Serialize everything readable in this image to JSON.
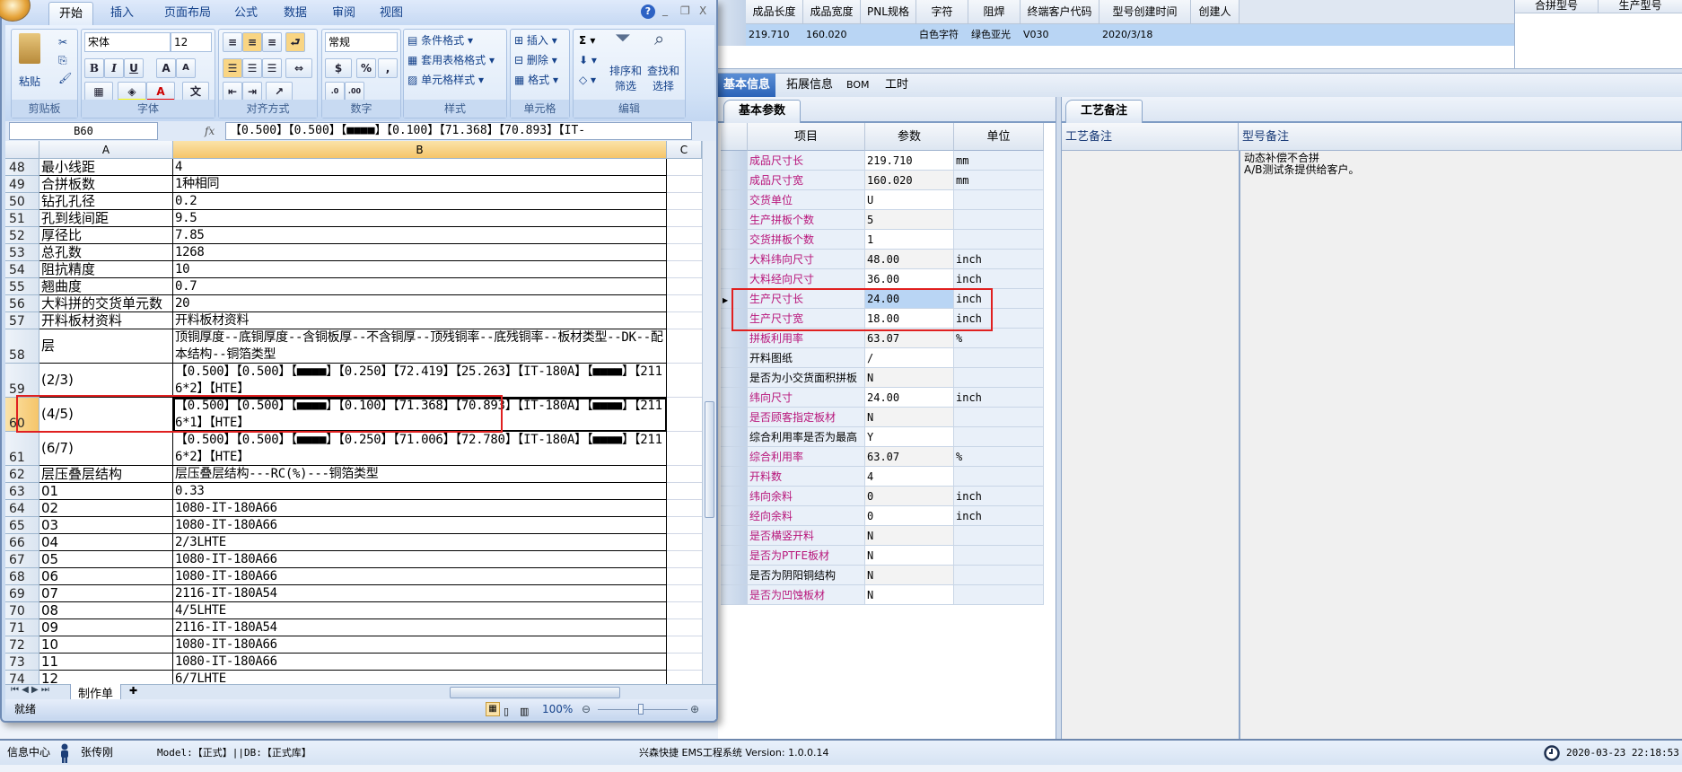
{
  "colors": {
    "accent": "#2b63b8",
    "highlight": "#e02020",
    "required_label": "#b8157a",
    "selected_row": "#b9d5f4"
  },
  "top_grid": {
    "headers": [
      "成品长度",
      "成品宽度",
      "PNL规格",
      "字符",
      "阻焊",
      "终端客户代码",
      "型号创建时间",
      "创建人"
    ],
    "row": [
      "219.710",
      "160.020",
      "",
      "白色字符",
      "绿色亚光",
      "V030",
      "2020/3/18",
      ""
    ],
    "merge_headers": [
      "合拼型号",
      "生产型号"
    ]
  },
  "main_tabs": [
    "基本信息",
    "拓展信息",
    "BOM",
    "工时"
  ],
  "left_subtab": "基本参数",
  "right_subtab": "工艺备注",
  "param_table": {
    "headers": [
      "项目",
      "参数",
      "单位"
    ],
    "rows": [
      {
        "item": "成品尺寸长",
        "value": "219.710",
        "unit": "mm",
        "req": true
      },
      {
        "item": "成品尺寸宽",
        "value": "160.020",
        "unit": "mm",
        "req": true
      },
      {
        "item": "交货单位",
        "value": "U",
        "unit": "",
        "req": true
      },
      {
        "item": "生产拼板个数",
        "value": "5",
        "unit": "",
        "req": true
      },
      {
        "item": "交货拼板个数",
        "value": "1",
        "unit": "",
        "req": true
      },
      {
        "item": "大料纬向尺寸",
        "value": "48.00",
        "unit": "inch",
        "req": true
      },
      {
        "item": "大料经向尺寸",
        "value": "36.00",
        "unit": "inch",
        "req": true
      },
      {
        "item": "生产尺寸长",
        "value": "24.00",
        "unit": "inch",
        "req": true,
        "selected": true
      },
      {
        "item": "生产尺寸宽",
        "value": "18.00",
        "unit": "inch",
        "req": true
      },
      {
        "item": "拼板利用率",
        "value": "63.07",
        "unit": "%",
        "req": true
      },
      {
        "item": "开料图纸",
        "value": "/",
        "unit": "",
        "req": false
      },
      {
        "item": "是否为小交货面积拼板",
        "value": "N",
        "unit": "",
        "req": false
      },
      {
        "item": "纬向尺寸",
        "value": "24.00",
        "unit": "inch",
        "req": true
      },
      {
        "item": "是否顾客指定板材",
        "value": "N",
        "unit": "",
        "req": true
      },
      {
        "item": "综合利用率是否为最高",
        "value": "Y",
        "unit": "",
        "req": false
      },
      {
        "item": "综合利用率",
        "value": "63.07",
        "unit": "%",
        "req": true
      },
      {
        "item": "开料数",
        "value": "4",
        "unit": "",
        "req": true
      },
      {
        "item": "纬向余料",
        "value": "0",
        "unit": "inch",
        "req": true
      },
      {
        "item": "经向余料",
        "value": "0",
        "unit": "inch",
        "req": true
      },
      {
        "item": "是否横竖开料",
        "value": "N",
        "unit": "",
        "req": true
      },
      {
        "item": "是否为PTFE板材",
        "value": "N",
        "unit": "",
        "req": true
      },
      {
        "item": "是否为阴阳铜结构",
        "value": "N",
        "unit": "",
        "req": false
      },
      {
        "item": "是否为凹蚀板材",
        "value": "N",
        "unit": "",
        "req": true
      }
    ]
  },
  "remarks": {
    "headers": [
      "工艺备注",
      "型号备注"
    ],
    "model_remark_lines": [
      "动态补偿不合拼",
      "A/B测试条提供给客户。"
    ]
  },
  "statusbar": {
    "info_center": "信息中心",
    "user": "张传刚",
    "model_db": "Model:【正式】||DB:【正式库】",
    "app": "兴森快捷 EMS工程系统 Version: 1.0.0.14",
    "datetime": "2020-03-23 22:18:53"
  },
  "excel": {
    "tabs": [
      "开始",
      "插入",
      "页面布局",
      "公式",
      "数据",
      "审阅",
      "视图"
    ],
    "window_buttons": [
      "?",
      "_",
      "❐",
      "X"
    ],
    "ribbon": {
      "groups": [
        "剪贴板",
        "字体",
        "对齐方式",
        "数字",
        "样式",
        "单元格",
        "编辑"
      ],
      "paste": "粘贴",
      "font_name": "宋体",
      "font_size": "12",
      "number_format": "常规",
      "cond_format": "条件格式",
      "table_format": "套用表格格式",
      "cell_style": "单元格样式",
      "insert": "插入",
      "delete": "删除",
      "format": "格式",
      "sort": "排序和\n筛选",
      "find": "查找和\n选择"
    },
    "name_box": "B60",
    "formula": "【0.500】【0.500】【■■■■】【0.100】【71.368】【70.893】【IT-",
    "columns": [
      "A",
      "B",
      "C"
    ],
    "rows": [
      {
        "n": "48",
        "a": "最小线距",
        "b": "4"
      },
      {
        "n": "49",
        "a": "合拼板数",
        "b": "1种相同"
      },
      {
        "n": "50",
        "a": "钻孔孔径",
        "b": "0.2"
      },
      {
        "n": "51",
        "a": "孔到线间距",
        "b": "9.5"
      },
      {
        "n": "52",
        "a": "厚径比",
        "b": "7.85"
      },
      {
        "n": "53",
        "a": "总孔数",
        "b": "1268"
      },
      {
        "n": "54",
        "a": "阻抗精度",
        "b": "10"
      },
      {
        "n": "55",
        "a": "翘曲度",
        "b": "0.7"
      },
      {
        "n": "56",
        "a": "大料拼的交货单元数",
        "b": "20"
      },
      {
        "n": "57",
        "a": "开料板材资料",
        "b": "开料板材资料"
      },
      {
        "n": "58",
        "a": "层",
        "b": "顶铜厚度--底铜厚度--含铜板厚--不含铜厚--顶残铜率--底残铜率--板材类型--DK--配本结构--铜箔类型",
        "dbl": true
      },
      {
        "n": "59",
        "a": "(2/3)",
        "b": "【0.500】【0.500】【■■■■】【0.250】【72.419】【25.263】【IT-180A】【■■■■】【2116*2】【HTE】",
        "dbl": true
      },
      {
        "n": "60",
        "a": "(4/5)",
        "b": "【0.500】【0.500】【■■■■】【0.100】【71.368】【70.893】【IT-180A】【■■■■】【2116*1】【HTE】",
        "dbl": true,
        "selected": true
      },
      {
        "n": "61",
        "a": "(6/7)",
        "b": "【0.500】【0.500】【■■■■】【0.250】【71.006】【72.780】【IT-180A】【■■■■】【2116*2】【HTE】",
        "dbl": true
      },
      {
        "n": "62",
        "a": "层压叠层结构",
        "b": "层压叠层结构---RC(%)---铜箔类型"
      },
      {
        "n": "63",
        "a": "01",
        "b": "0.33"
      },
      {
        "n": "64",
        "a": "02",
        "b": "1080-IT-180A66"
      },
      {
        "n": "65",
        "a": "03",
        "b": "1080-IT-180A66"
      },
      {
        "n": "66",
        "a": "04",
        "b": "2/3LHTE"
      },
      {
        "n": "67",
        "a": "05",
        "b": "1080-IT-180A66"
      },
      {
        "n": "68",
        "a": "06",
        "b": "1080-IT-180A66"
      },
      {
        "n": "69",
        "a": "07",
        "b": "2116-IT-180A54"
      },
      {
        "n": "70",
        "a": "08",
        "b": "4/5LHTE"
      },
      {
        "n": "71",
        "a": "09",
        "b": "2116-IT-180A54"
      },
      {
        "n": "72",
        "a": "10",
        "b": "1080-IT-180A66"
      },
      {
        "n": "73",
        "a": "11",
        "b": "1080-IT-180A66"
      },
      {
        "n": "74",
        "a": "12",
        "b": "6/7LHTE"
      }
    ],
    "sheet_tab": "制作单",
    "status": "就绪",
    "zoom": "100%"
  }
}
